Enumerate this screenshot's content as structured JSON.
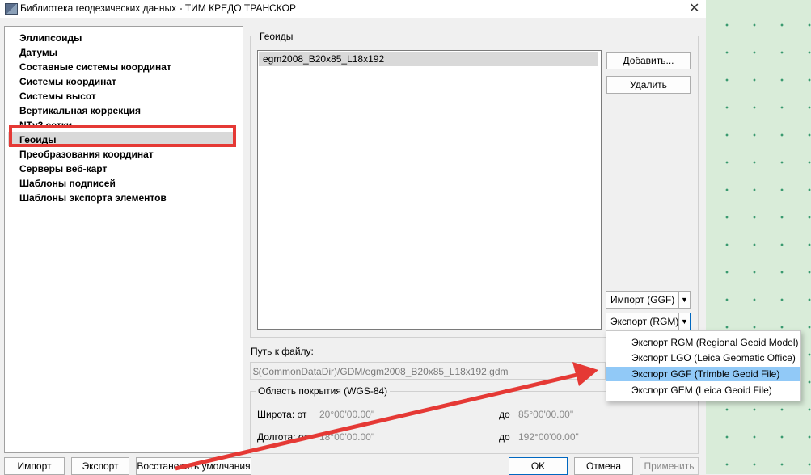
{
  "window": {
    "title": "Библиотека геодезических данных - ТИМ КРЕДО ТРАНСКОР",
    "close_glyph": "✕"
  },
  "categories": [
    "Эллипсоиды",
    "Датумы",
    "Составные системы координат",
    "Системы координат",
    "Системы высот",
    "Вертикальная коррекция",
    "NTv2 сетки",
    "Геоиды",
    "Преобразования координат",
    "Серверы веб-карт",
    "Шаблоны подписей",
    "Шаблоны экспорта элементов"
  ],
  "selected_category": "Геоиды",
  "geoids": {
    "group_title": "Геоиды",
    "items": [
      "egm2008_B20x85_L18x192"
    ],
    "add_label": "Добавить...",
    "delete_label": "Удалить",
    "import_label": "Импорт (GGF)",
    "export_label": "Экспорт (RGM)",
    "dropdown_glyph": "▼"
  },
  "export_menu": [
    "Экспорт RGM (Regional Geoid Model)",
    "Экспорт LGO (Leica Geomatic Office)",
    "Экспорт GGF (Trimble Geoid File)",
    "Экспорт GEM (Leica Geoid File)"
  ],
  "highlighted_menu_item": "Экспорт GGF (Trimble Geoid File)",
  "file_path": {
    "label": "Путь к файлу:",
    "value": "$(CommonDataDir)/GDM/egm2008_B20x85_L18x192.gdm"
  },
  "coverage": {
    "title": "Область покрытия (WGS-84)",
    "lat_label": "Широта: от",
    "lat_from": "20°00'00.00\"",
    "lat_to_label": "до",
    "lat_to": "85°00'00.00\"",
    "lon_label": "Долгота: от",
    "lon_from": "18°00'00.00\"",
    "lon_to_label": "до",
    "lon_to": "192°00'00.00\""
  },
  "footer": {
    "import_label": "Импорт",
    "export_label": "Экспорт",
    "restore_label": "Восстановить умолчания",
    "ok_label": "OK",
    "cancel_label": "Отмена",
    "apply_label": "Применить"
  },
  "colors": {
    "annotation_red": "#e53935",
    "menu_highlight": "#91c9f7",
    "accent_blue": "#0067c0"
  }
}
